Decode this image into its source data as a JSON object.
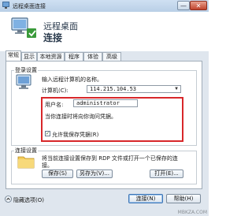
{
  "window": {
    "title": "远程桌面连接"
  },
  "titlebar": {
    "minimize": "—",
    "close": "✕"
  },
  "header": {
    "line1": "远程桌面",
    "line2": "连接"
  },
  "tabs": [
    {
      "label": "常规"
    },
    {
      "label": "显示"
    },
    {
      "label": "本地资源"
    },
    {
      "label": "程序"
    },
    {
      "label": "体验"
    },
    {
      "label": "高级"
    }
  ],
  "login": {
    "group_title": "登录设置",
    "prompt": "输入远程计算机的名称。",
    "computer_label": "计算机(C):",
    "computer_value": "114.215.104.53",
    "user_label": "用户名:",
    "user_value": "administrator",
    "notice": "当你连接时将向你询问凭据。",
    "save_checkbox": "允许我保存凭据(R)",
    "save_checked": true
  },
  "connection": {
    "group_title": "连接设置",
    "desc_line1": "将当前连接设置保存到 RDP 文件或打开一个已保存的连",
    "desc_line2": "接。",
    "save": "保存(S)",
    "save_as": "另存为(V)...",
    "open": "打开(E)..."
  },
  "footer": {
    "options": "隐藏选项(O)",
    "connect": "连接(N)",
    "help": "帮助(H)"
  },
  "watermark": "MBKZA.COM",
  "colors": {
    "highlight_box": "#d8272a",
    "title_gradient": "#b9cfe6"
  }
}
